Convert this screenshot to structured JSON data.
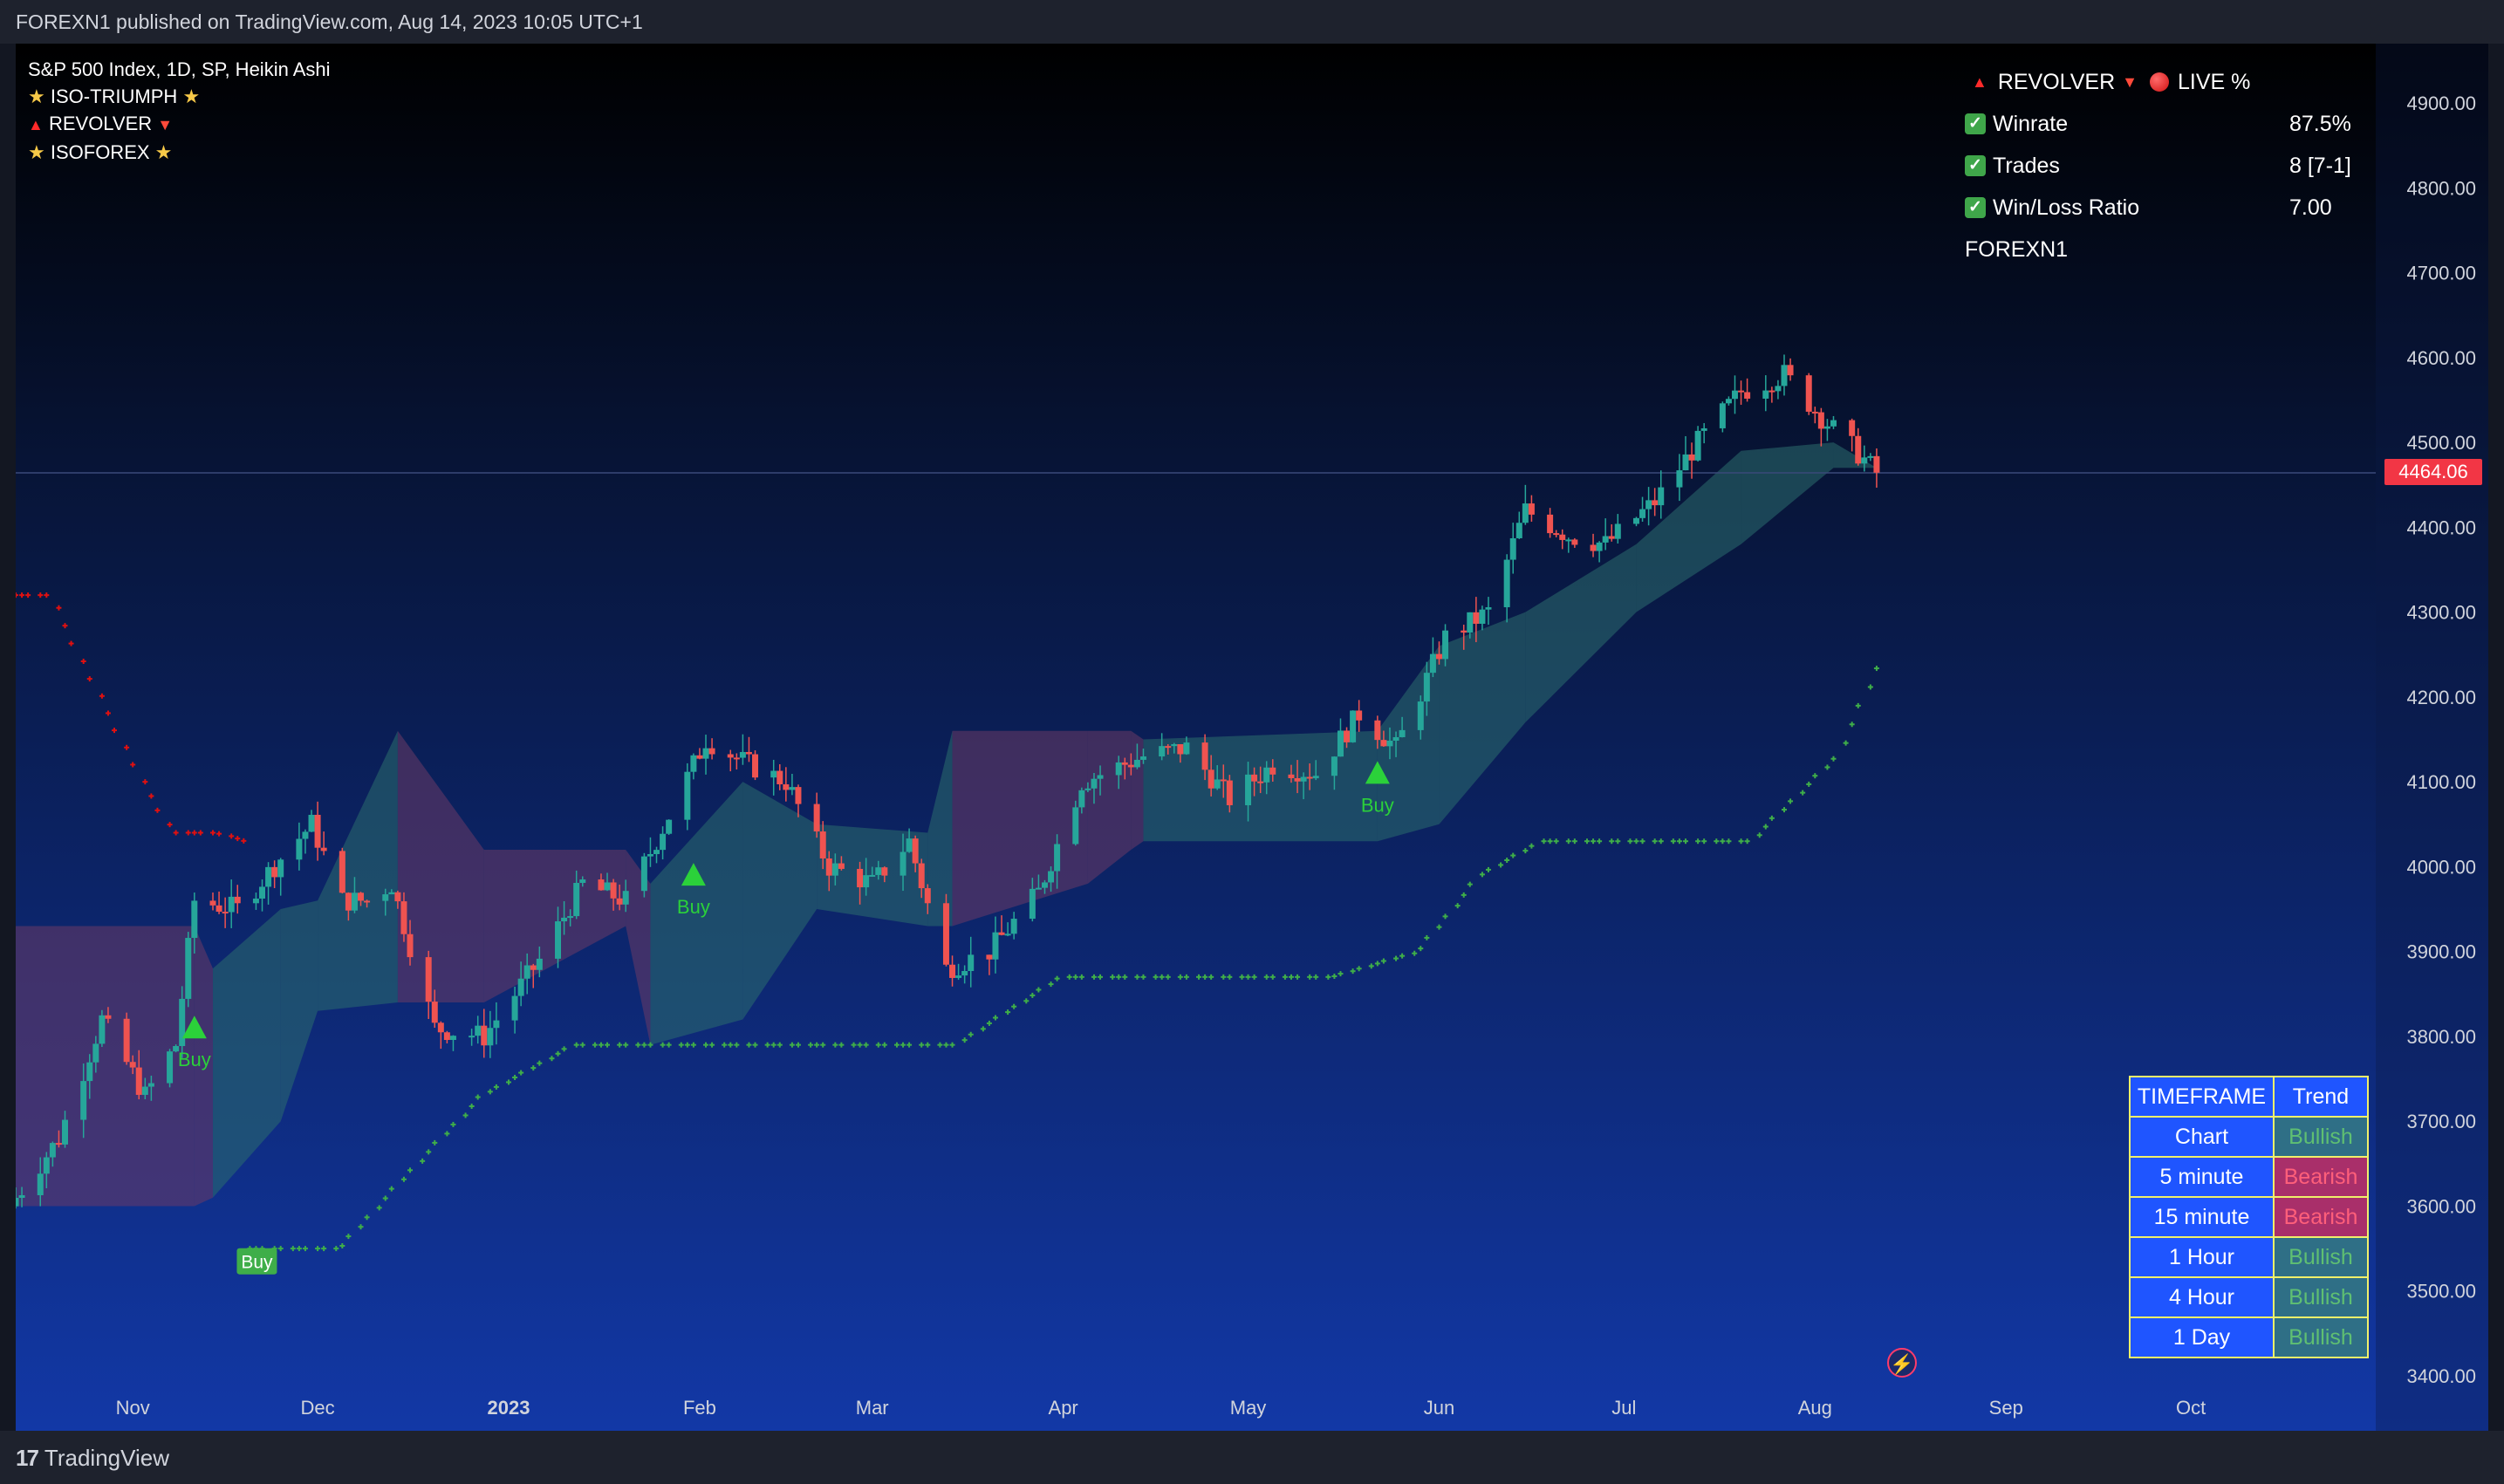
{
  "header": {
    "published_text": "FOREXN1 published on TradingView.com, Aug 14, 2023 10:05 UTC+1"
  },
  "footer": {
    "logo_mark": "17",
    "logo_text": "TradingView"
  },
  "legend": {
    "symbol": "S&P 500 Index, 1D, SP, Heikin Ashi",
    "indicators": [
      "ISO-TRIUMPH",
      "REVOLVER",
      "ISOFOREX"
    ]
  },
  "stats_panel": {
    "title_left": "REVOLVER",
    "title_right": "LIVE %",
    "rows": [
      {
        "label": "Winrate",
        "value": "87.5%"
      },
      {
        "label": "Trades",
        "value": "8 [7-1]"
      },
      {
        "label": "Win/Loss Ratio",
        "value": "7.00"
      }
    ],
    "author": "FOREXN1"
  },
  "last_price": "4464.06",
  "timeframe_table": {
    "headers": [
      "TIMEFRAME",
      "Trend"
    ],
    "rows": [
      {
        "timeframe": "Chart",
        "trend": "Bullish"
      },
      {
        "timeframe": "5 minute",
        "trend": "Bearish"
      },
      {
        "timeframe": "15 minute",
        "trend": "Bearish"
      },
      {
        "timeframe": "1 Hour",
        "trend": "Bullish"
      },
      {
        "timeframe": "4 Hour",
        "trend": "Bullish"
      },
      {
        "timeframe": "1 Day",
        "trend": "Bullish"
      }
    ]
  },
  "colors": {
    "bull": "#26a69a",
    "bear": "#ef5350",
    "buy_signal": "#2bd13a",
    "trail_green": "#3fae49",
    "trail_red": "#e01010",
    "last_price": "#f23645"
  },
  "chart_data": {
    "type": "candlestick",
    "title": "S&P 500 Index, 1D, SP, Heikin Ashi",
    "y_ticks": [
      4900,
      4800,
      4700,
      4600,
      4500,
      4400,
      4300,
      4200,
      4100,
      4000,
      3900,
      3800,
      3700,
      3600,
      3500,
      3400
    ],
    "ylim": [
      3350,
      4960
    ],
    "x_ticks": [
      "Nov",
      "Dec",
      "2023",
      "Feb",
      "Mar",
      "Apr",
      "May",
      "Jun",
      "Jul",
      "Aug",
      "Sep",
      "Oct"
    ],
    "x_tick_dates": [
      "2022-11-01",
      "2022-12-01",
      "2023-01-01",
      "2023-02-01",
      "2023-03-01",
      "2023-04-01",
      "2023-05-01",
      "2023-06-01",
      "2023-07-01",
      "2023-08-01",
      "2023-09-01",
      "2023-10-01"
    ],
    "xlim": [
      "2022-10-13",
      "2023-10-31"
    ],
    "price_path": [
      {
        "date": "2022-10-13",
        "close": 3610
      },
      {
        "date": "2022-10-20",
        "close": 3680
      },
      {
        "date": "2022-10-27",
        "close": 3820
      },
      {
        "date": "2022-11-03",
        "close": 3730
      },
      {
        "date": "2022-11-08",
        "close": 3790
      },
      {
        "date": "2022-11-11",
        "close": 3960
      },
      {
        "date": "2022-11-18",
        "close": 3950
      },
      {
        "date": "2022-11-25",
        "close": 4010
      },
      {
        "date": "2022-11-30",
        "close": 4050
      },
      {
        "date": "2022-12-05",
        "close": 3960
      },
      {
        "date": "2022-12-09",
        "close": 3960
      },
      {
        "date": "2022-12-13",
        "close": 3980
      },
      {
        "date": "2022-12-20",
        "close": 3810
      },
      {
        "date": "2022-12-28",
        "close": 3800
      },
      {
        "date": "2023-01-06",
        "close": 3890
      },
      {
        "date": "2023-01-13",
        "close": 3980
      },
      {
        "date": "2023-01-20",
        "close": 3960
      },
      {
        "date": "2023-01-27",
        "close": 4060
      },
      {
        "date": "2023-02-02",
        "close": 4150
      },
      {
        "date": "2023-02-09",
        "close": 4120
      },
      {
        "date": "2023-02-15",
        "close": 4100
      },
      {
        "date": "2023-02-22",
        "close": 4000
      },
      {
        "date": "2023-03-01",
        "close": 3980
      },
      {
        "date": "2023-03-07",
        "close": 4030
      },
      {
        "date": "2023-03-13",
        "close": 3880
      },
      {
        "date": "2023-03-20",
        "close": 3900
      },
      {
        "date": "2023-03-28",
        "close": 3970
      },
      {
        "date": "2023-04-04",
        "close": 4100
      },
      {
        "date": "2023-04-14",
        "close": 4130
      },
      {
        "date": "2023-04-21",
        "close": 4140
      },
      {
        "date": "2023-04-28",
        "close": 4080
      },
      {
        "date": "2023-05-05",
        "close": 4120
      },
      {
        "date": "2023-05-12",
        "close": 4110
      },
      {
        "date": "2023-05-19",
        "close": 4180
      },
      {
        "date": "2023-05-25",
        "close": 4140
      },
      {
        "date": "2023-06-02",
        "close": 4270
      },
      {
        "date": "2023-06-09",
        "close": 4300
      },
      {
        "date": "2023-06-15",
        "close": 4420
      },
      {
        "date": "2023-06-22",
        "close": 4390
      },
      {
        "date": "2023-06-28",
        "close": 4380
      },
      {
        "date": "2023-07-06",
        "close": 4430
      },
      {
        "date": "2023-07-13",
        "close": 4500
      },
      {
        "date": "2023-07-20",
        "close": 4560
      },
      {
        "date": "2023-07-27",
        "close": 4580
      },
      {
        "date": "2023-08-02",
        "close": 4530
      },
      {
        "date": "2023-08-09",
        "close": 4480
      },
      {
        "date": "2023-08-11",
        "close": 4464
      }
    ],
    "green_trailing_stop": [
      {
        "date": "2022-11-20",
        "value": 3550
      },
      {
        "date": "2022-12-05",
        "value": 3550
      },
      {
        "date": "2022-12-15",
        "value": 3630
      },
      {
        "date": "2022-12-28",
        "value": 3730
      },
      {
        "date": "2023-01-12",
        "value": 3790
      },
      {
        "date": "2023-03-15",
        "value": 3790
      },
      {
        "date": "2023-04-01",
        "value": 3870
      },
      {
        "date": "2023-05-15",
        "value": 3870
      },
      {
        "date": "2023-05-29",
        "value": 3900
      },
      {
        "date": "2023-06-08",
        "value": 3990
      },
      {
        "date": "2023-06-18",
        "value": 4030
      },
      {
        "date": "2023-07-22",
        "value": 4030
      },
      {
        "date": "2023-08-05",
        "value": 4130
      },
      {
        "date": "2023-08-12",
        "value": 4240
      }
    ],
    "red_trailing_stop": [
      {
        "date": "2022-10-13",
        "value": 4320
      },
      {
        "date": "2022-10-19",
        "value": 4320
      },
      {
        "date": "2022-10-25",
        "value": 4230
      },
      {
        "date": "2022-11-03",
        "value": 4100
      },
      {
        "date": "2022-11-08",
        "value": 4040
      },
      {
        "date": "2022-11-15",
        "value": 4040
      },
      {
        "date": "2022-11-20",
        "value": 4030
      }
    ],
    "cloud": [
      {
        "date": "2022-10-13",
        "top": 3930,
        "bottom": 3600,
        "state": "bearish"
      },
      {
        "date": "2022-11-11",
        "top": 3930,
        "bottom": 3600,
        "state": "bearish"
      },
      {
        "date": "2022-11-14",
        "top": 3880,
        "bottom": 3610,
        "state": "bullish"
      },
      {
        "date": "2022-11-25",
        "top": 3950,
        "bottom": 3700,
        "state": "bullish"
      },
      {
        "date": "2022-12-01",
        "top": 3960,
        "bottom": 3830,
        "state": "bullish"
      },
      {
        "date": "2022-12-14",
        "top": 4160,
        "bottom": 3840,
        "state": "bearish"
      },
      {
        "date": "2022-12-28",
        "top": 4020,
        "bottom": 3840,
        "state": "bearish"
      },
      {
        "date": "2023-01-20",
        "top": 4020,
        "bottom": 3930,
        "state": "bearish"
      },
      {
        "date": "2023-01-24",
        "top": 3980,
        "bottom": 3790,
        "state": "bullish"
      },
      {
        "date": "2023-02-08",
        "top": 4100,
        "bottom": 3820,
        "state": "bullish"
      },
      {
        "date": "2023-02-20",
        "top": 4050,
        "bottom": 3950,
        "state": "bullish"
      },
      {
        "date": "2023-03-10",
        "top": 4040,
        "bottom": 3930,
        "state": "bullish"
      },
      {
        "date": "2023-03-14",
        "top": 4160,
        "bottom": 3930,
        "state": "bearish"
      },
      {
        "date": "2023-04-05",
        "top": 4160,
        "bottom": 3980,
        "state": "bearish"
      },
      {
        "date": "2023-04-12",
        "top": 4160,
        "bottom": 4020,
        "state": "bearish"
      },
      {
        "date": "2023-04-14",
        "top": 4150,
        "bottom": 4030,
        "state": "bullish"
      },
      {
        "date": "2023-05-22",
        "top": 4160,
        "bottom": 4030,
        "state": "bullish"
      },
      {
        "date": "2023-06-01",
        "top": 4260,
        "bottom": 4050,
        "state": "bullish"
      },
      {
        "date": "2023-06-15",
        "top": 4300,
        "bottom": 4170,
        "state": "bullish"
      },
      {
        "date": "2023-07-03",
        "top": 4380,
        "bottom": 4300,
        "state": "bullish"
      },
      {
        "date": "2023-07-20",
        "top": 4490,
        "bottom": 4380,
        "state": "bullish"
      },
      {
        "date": "2023-08-04",
        "top": 4500,
        "bottom": 4470,
        "state": "bullish"
      },
      {
        "date": "2023-08-11",
        "top": 4470,
        "bottom": 4470,
        "state": "bullish"
      }
    ],
    "signals": [
      {
        "date": "2022-11-11",
        "price": 3810,
        "label": "Buy"
      },
      {
        "date": "2023-01-31",
        "price": 3990,
        "label": "Buy"
      },
      {
        "date": "2023-05-22",
        "price": 4110,
        "label": "Buy"
      },
      {
        "date": "2022-11-21",
        "price": 3535,
        "label": "Buy",
        "style": "box"
      }
    ]
  }
}
